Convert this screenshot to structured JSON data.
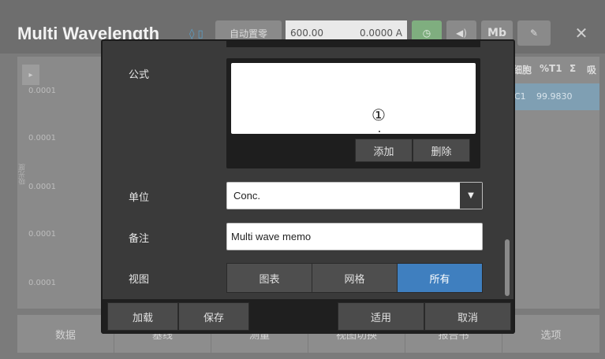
{
  "app": {
    "title": "Multi Wavelength",
    "header": {
      "auto_zero": "自动置零",
      "wavelength": "600.00",
      "reading": "0.0000 A",
      "ntc_label": "Mb"
    },
    "chart": {
      "ticks": [
        "0.0001",
        "0.0001",
        "0.0001",
        "0.0001",
        "0.0001"
      ],
      "ylabel": "吸光度"
    },
    "table": {
      "headers": [
        "细胞",
        "%T1",
        "Σ",
        "吸"
      ],
      "row": [
        "C1",
        "99.9830"
      ]
    },
    "bottom_nav": [
      "数据",
      "基线",
      "测量",
      "视图切换",
      "报告书",
      "选项"
    ]
  },
  "dialog": {
    "formula_label": "公式",
    "formula_value": "",
    "marker": "①",
    "add_button": "添加",
    "delete_button": "删除",
    "unit_label": "单位",
    "unit_value": "Conc.",
    "memo_label": "备注",
    "memo_value": "Multi wave memo",
    "view_label": "视图",
    "view_options": [
      "图表",
      "网格",
      "所有"
    ],
    "view_selected": "所有",
    "footer": {
      "load": "加载",
      "save": "保存",
      "apply": "适用",
      "cancel": "取消"
    }
  },
  "colors": {
    "accent": "#3f7fbf",
    "dialog_bg": "#3a3a3a",
    "header_green": "#7fae7f"
  }
}
